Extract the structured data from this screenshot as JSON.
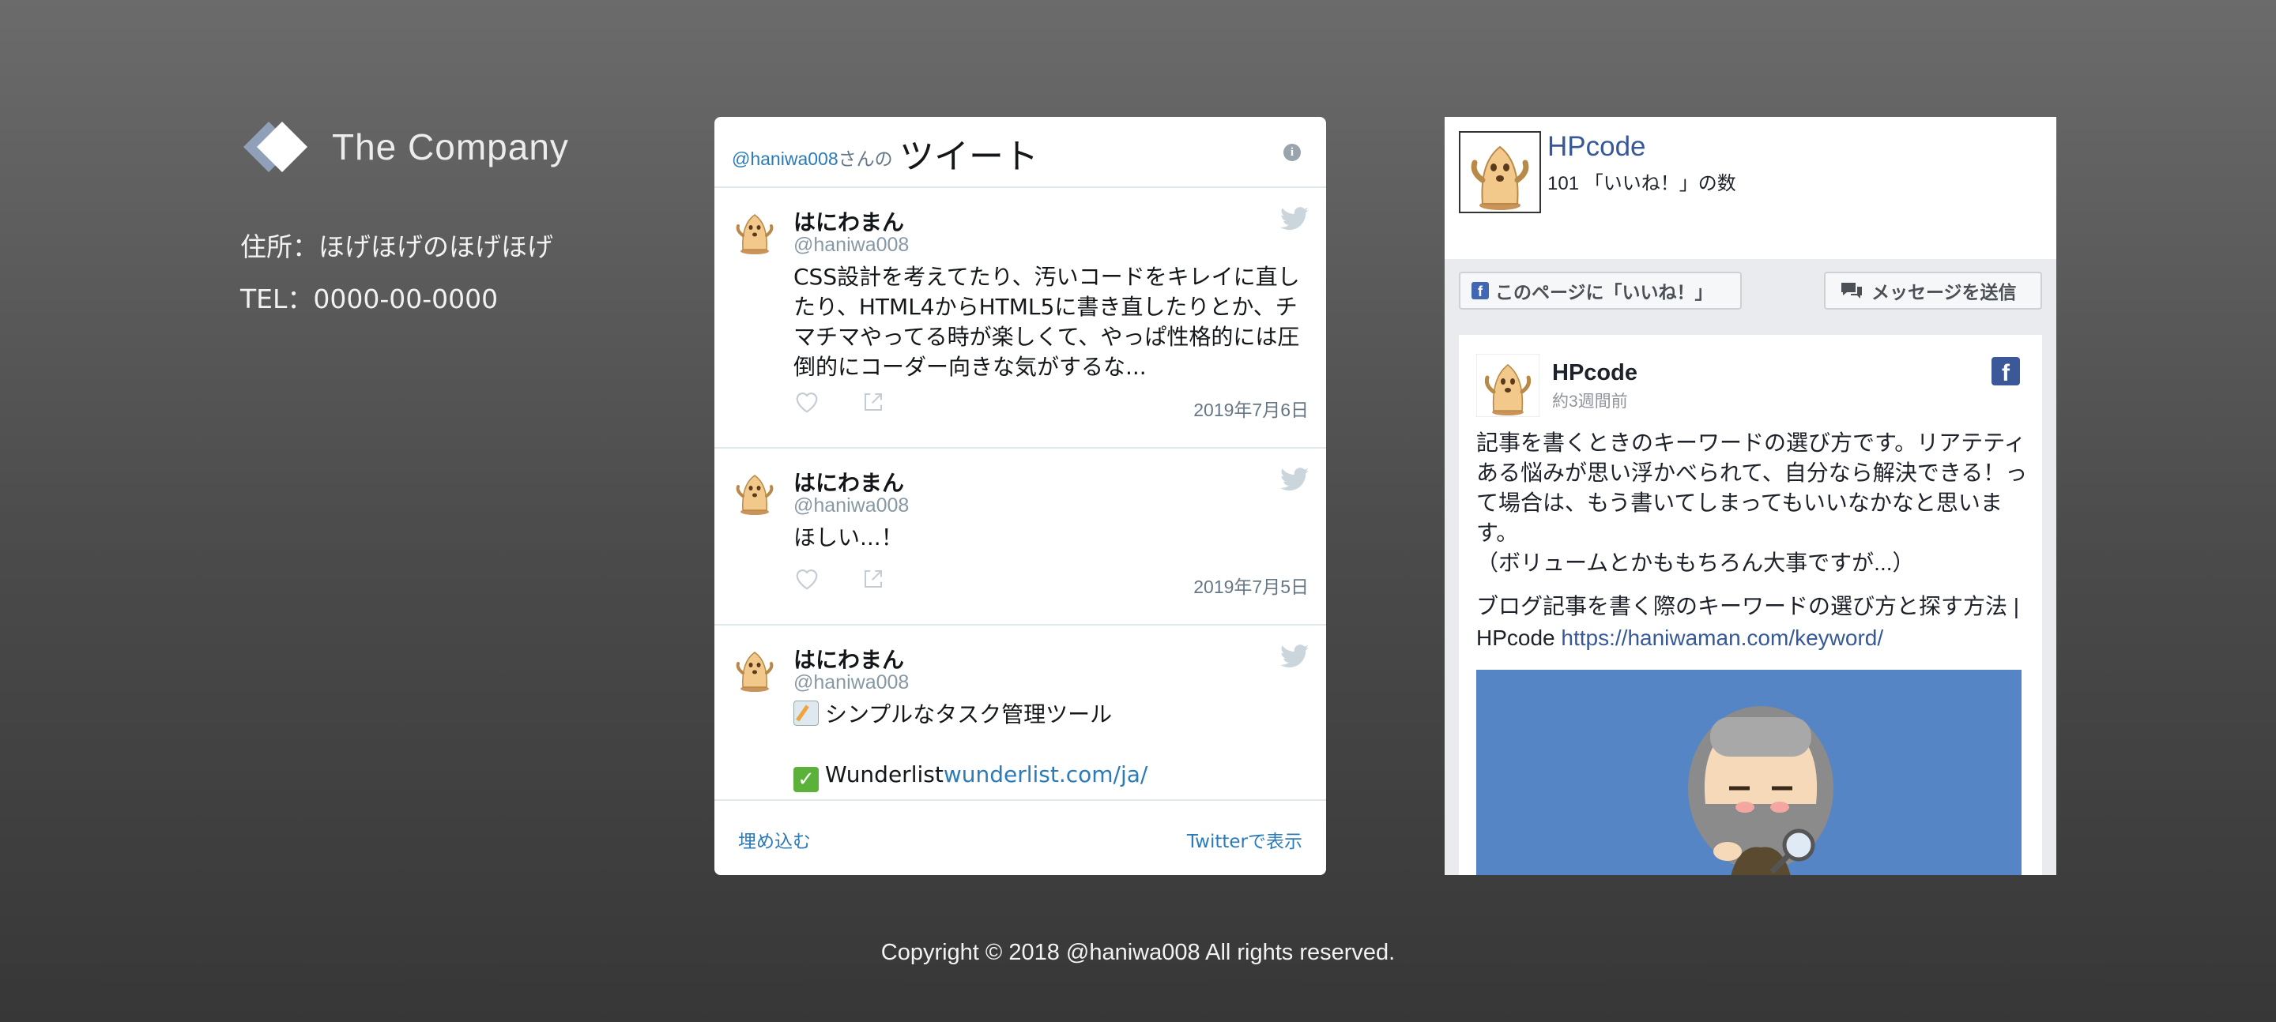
{
  "company": {
    "name": "The Company",
    "address": "住所：ほげほげのほげほげ",
    "tel": "TEL：0000-00-0000"
  },
  "twitter": {
    "header_handle": "@haniwa008",
    "header_suffix": "さんの",
    "header_title": "ツイート",
    "tweets": [
      {
        "name": "はにわまん",
        "handle": "@haniwa008",
        "text": "CSS設計を考えてたり、汚いコードをキレイに直したり、HTML4からHTML5に書き直したりとか、チマチマやってる時が楽しくて、やっぱ性格的には圧倒的にコーダー向きな気がするな...",
        "date": "2019年7月6日"
      },
      {
        "name": "はにわまん",
        "handle": "@haniwa008",
        "text": "ほしい...！",
        "date": "2019年7月5日"
      },
      {
        "name": "はにわまん",
        "handle": "@haniwa008",
        "line1": "シンプルなタスク管理ツール",
        "line2_text": "Wunderlist",
        "line2_link": "wunderlist.com/ja/"
      }
    ],
    "footer_embed": "埋め込む",
    "footer_view": "Twitterで表示",
    "link_color": "#2b7bb9"
  },
  "facebook": {
    "page_name": "HPcode",
    "likes": "101 「いいね！」の数",
    "like_button": "このページに「いいね！」",
    "message_button": "メッセージを送信",
    "post": {
      "name": "HPcode",
      "time": "約3週間前",
      "text": "記事を書くときのキーワードの選び方です。リアテティある悩みが思い浮かべられて、自分なら解決できる！って場合は、もう書いてしまってもいいなかなと思います。\n（ボリュームとかももちろん大事ですが...）",
      "link_title": "ブログ記事を書く際のキーワードの選び方と探す方法 | HPcode",
      "link_url": "https://haniwaman.com/keyword/"
    },
    "brand_color": "#3b5998"
  },
  "footer": {
    "copyright": "Copyright © 2018 @haniwa008 All rights reserved."
  }
}
